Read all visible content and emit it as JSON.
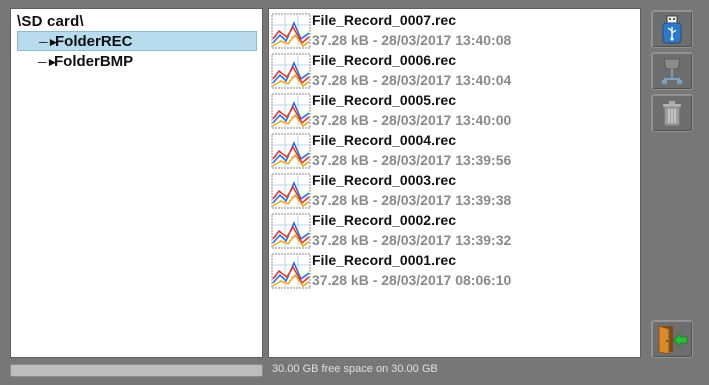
{
  "tree": {
    "root_label": "\\SD card\\",
    "items": [
      {
        "label": "FolderREC",
        "selected": true
      },
      {
        "label": "FolderBMP",
        "selected": false
      }
    ]
  },
  "files": [
    {
      "name": "File_Record_0007.rec",
      "meta": "37.28 kB - 28/03/2017 13:40:08"
    },
    {
      "name": "File_Record_0006.rec",
      "meta": "37.28 kB - 28/03/2017 13:40:04"
    },
    {
      "name": "File_Record_0005.rec",
      "meta": "37.28 kB - 28/03/2017 13:40:00"
    },
    {
      "name": "File_Record_0004.rec",
      "meta": "37.28 kB - 28/03/2017 13:39:56"
    },
    {
      "name": "File_Record_0003.rec",
      "meta": "37.28 kB - 28/03/2017 13:39:38"
    },
    {
      "name": "File_Record_0002.rec",
      "meta": "37.28 kB - 28/03/2017 13:39:32"
    },
    {
      "name": "File_Record_0001.rec",
      "meta": "37.28 kB - 28/03/2017 08:06:10"
    }
  ],
  "toolbar": {
    "buttons": [
      {
        "icon": "usb-drive-icon",
        "enabled": true
      },
      {
        "icon": "network-share-icon",
        "enabled": false
      },
      {
        "icon": "trash-icon",
        "enabled": false
      },
      {
        "icon": "exit-door-icon",
        "enabled": true
      }
    ]
  },
  "storage": {
    "free_space_text": "30.00 GB free space on 30.00 GB",
    "used_fraction": 0.0
  },
  "colors": {
    "background": "#777777",
    "selection": "#b9dbee",
    "meta_text": "#8a8a8a",
    "usb_blue": "#2f78c8",
    "exit_green": "#2bbf3d",
    "door_orange": "#d98a2b"
  }
}
